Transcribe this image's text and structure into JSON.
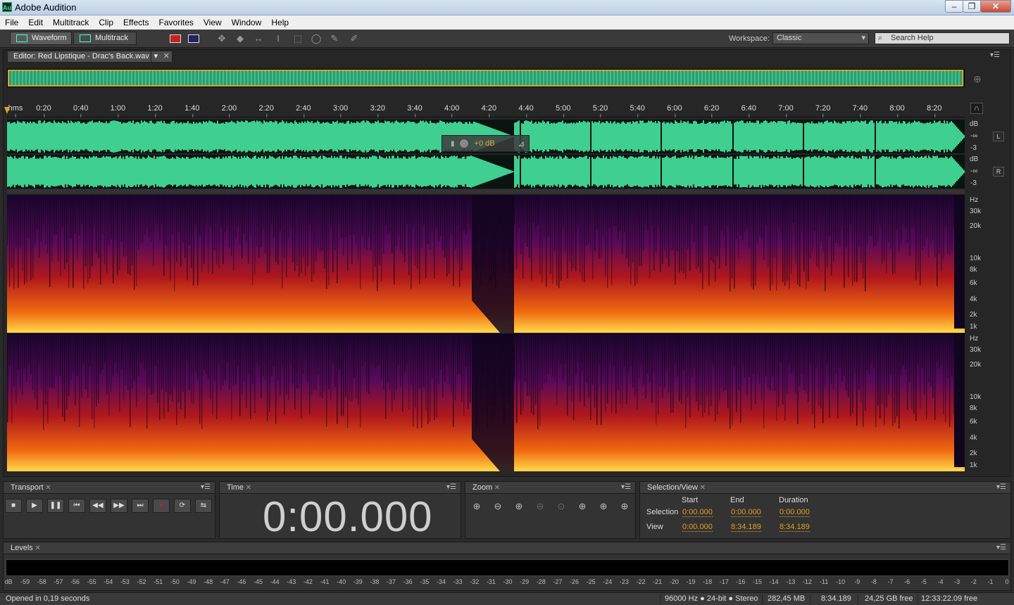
{
  "window": {
    "title": "Adobe Audition",
    "app_icon": "Au"
  },
  "menu": [
    "File",
    "Edit",
    "Multitrack",
    "Clip",
    "Effects",
    "Favorites",
    "View",
    "Window",
    "Help"
  ],
  "toolbar": {
    "waveform_label": "Waveform",
    "multitrack_label": "Multitrack",
    "workspace_label": "Workspace:",
    "workspace_value": "Classic",
    "search_placeholder": "Search Help"
  },
  "editor": {
    "tab_label": "Editor: Red Lipstique - Drac's Back.wav",
    "time_ruler": [
      "hms",
      "0:20",
      "0:40",
      "1:00",
      "1:20",
      "1:40",
      "2:00",
      "2:20",
      "2:40",
      "3:00",
      "3:20",
      "3:40",
      "4:00",
      "4:20",
      "4:40",
      "5:00",
      "5:20",
      "5:40",
      "6:00",
      "6:20",
      "6:40",
      "7:00",
      "7:20",
      "7:40",
      "8:00",
      "8:20"
    ],
    "gain_hud": "+0 dB",
    "db_scale_L": [
      "dB",
      "-∞",
      "-3"
    ],
    "db_scale_R": [
      "dB",
      "-∞",
      "-3"
    ],
    "channel_L": "L",
    "channel_R": "R",
    "hz_scale_top": [
      "Hz",
      "30k",
      "20k",
      "10k",
      "8k",
      "6k",
      "4k",
      "2k",
      "1k"
    ],
    "hz_scale_bottom": [
      "Hz",
      "30k",
      "20k",
      "10k",
      "8k",
      "6k",
      "4k",
      "2k",
      "1k"
    ]
  },
  "transport": {
    "title": "Transport"
  },
  "time": {
    "title": "Time",
    "value": "0:00.000"
  },
  "zoom": {
    "title": "Zoom"
  },
  "selection_view": {
    "title": "Selection/View",
    "headers": [
      "Start",
      "End",
      "Duration"
    ],
    "selection_label": "Selection",
    "view_label": "View",
    "selection": [
      "0:00.000",
      "0:00.000",
      "0:00.000"
    ],
    "view": [
      "0:00.000",
      "8:34.189",
      "8:34.189"
    ]
  },
  "levels": {
    "title": "Levels",
    "ticks": [
      "dB",
      "-59",
      "-58",
      "-57",
      "-56",
      "-55",
      "-54",
      "-53",
      "-52",
      "-51",
      "-50",
      "-49",
      "-48",
      "-47",
      "-46",
      "-45",
      "-44",
      "-43",
      "-42",
      "-41",
      "-40",
      "-39",
      "-38",
      "-37",
      "-36",
      "-35",
      "-34",
      "-33",
      "-32",
      "-31",
      "-30",
      "-29",
      "-28",
      "-27",
      "-26",
      "-25",
      "-24",
      "-23",
      "-22",
      "-21",
      "-20",
      "-19",
      "-18",
      "-17",
      "-16",
      "-15",
      "-14",
      "-13",
      "-12",
      "-11",
      "-10",
      "-9",
      "-8",
      "-7",
      "-6",
      "-5",
      "-4",
      "-3",
      "-2",
      "-1",
      "0"
    ]
  },
  "status": {
    "message": "Opened in 0,19 seconds",
    "format": "96000 Hz ● 24-bit ● Stereo",
    "size": "282,45 MB",
    "duration": "8:34.189",
    "free": "24,25 GB free",
    "free_time": "12:33:22.09 free"
  },
  "colors": {
    "waveform": "#3ecf91",
    "accent": "#e0a020",
    "record": "#c62020"
  }
}
